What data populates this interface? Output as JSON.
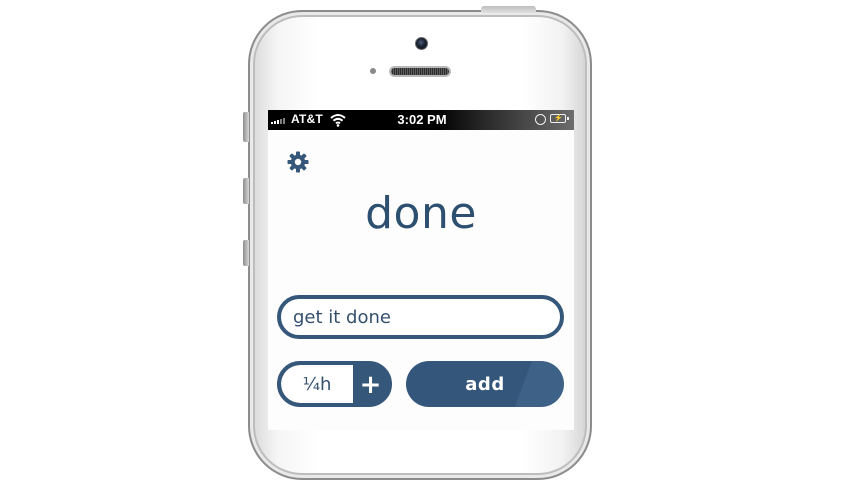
{
  "status_bar": {
    "carrier": "AT&T",
    "time": "3:02 PM",
    "battery_glyph": "⚡"
  },
  "app": {
    "title": "done",
    "settings_icon": "gear-icon",
    "task_input": {
      "value": "get it done"
    },
    "duration": {
      "value": "¼h",
      "increment_label": "+"
    },
    "add_label": "add"
  },
  "colors": {
    "accent": "#35577a",
    "title": "#2e5070"
  }
}
